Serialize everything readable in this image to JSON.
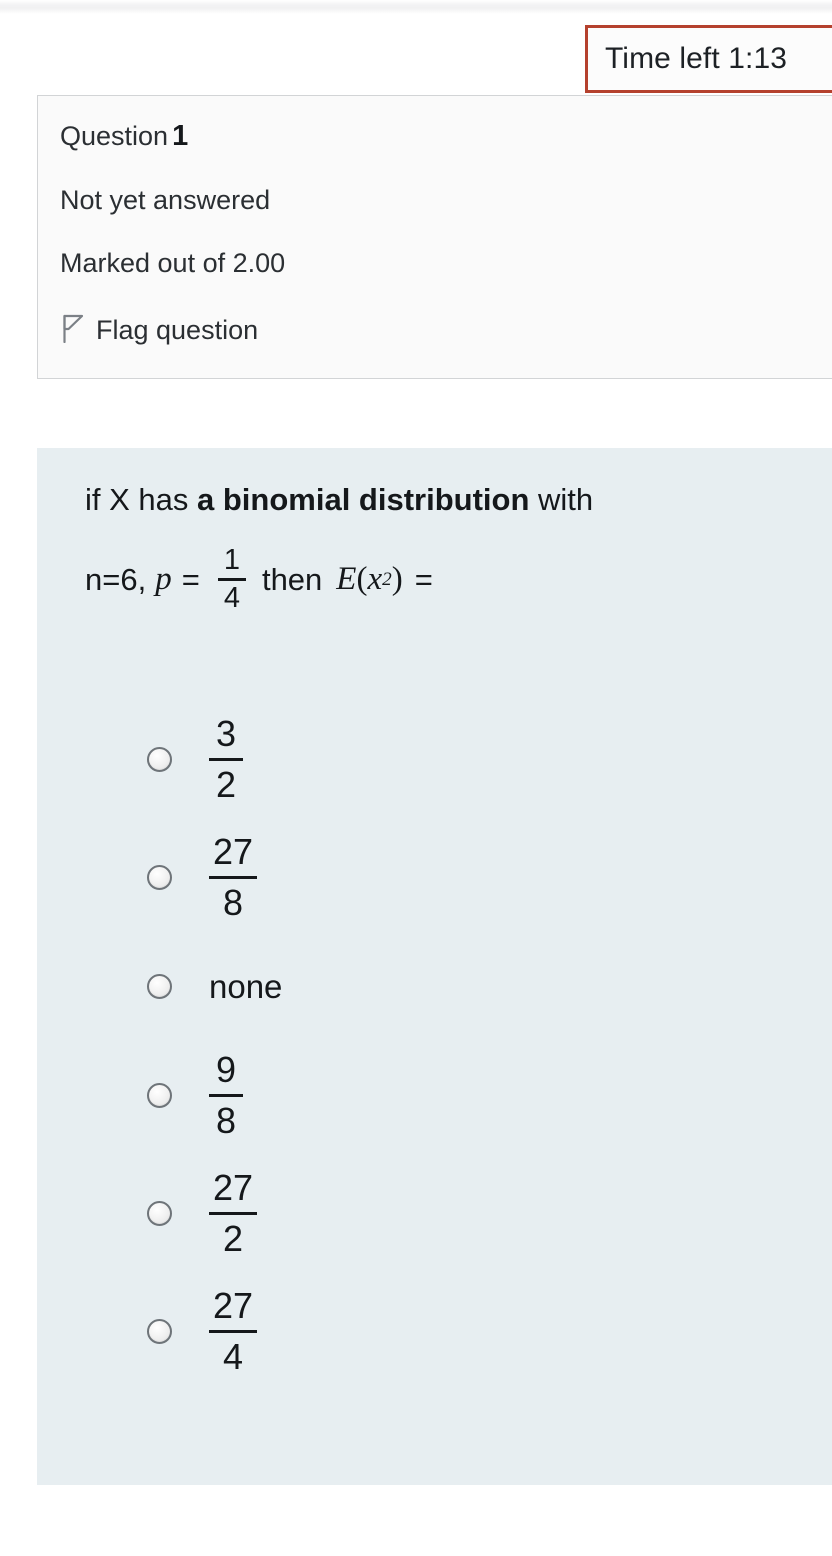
{
  "timer": {
    "label": "Time left 1:13",
    "border_color": "#b5412e"
  },
  "question_info": {
    "question_label": "Question",
    "question_number": "1",
    "status": "Not yet answered",
    "marks": "Marked out of 2.00",
    "flag_label": "Flag question",
    "flag_icon": "flag-icon"
  },
  "question": {
    "line1_prefix": "if X has ",
    "line1_bold": "a binomial distribution",
    "line1_suffix": " with",
    "given_n": "n=6,",
    "var_p": "p",
    "equals": "=",
    "p_numerator": "1",
    "p_denominator": "4",
    "then_word": "then",
    "expectation_E": "E",
    "paren_open": "(",
    "var_x": "x",
    "exponent": "2",
    "paren_close": ")",
    "trailing_equals": "="
  },
  "options": [
    {
      "id": "opt-1",
      "kind": "fraction",
      "numerator": "3",
      "denominator": "2"
    },
    {
      "id": "opt-2",
      "kind": "fraction",
      "numerator": "27",
      "denominator": "8"
    },
    {
      "id": "opt-3",
      "kind": "text",
      "text": "none"
    },
    {
      "id": "opt-4",
      "kind": "fraction",
      "numerator": "9",
      "denominator": "8"
    },
    {
      "id": "opt-5",
      "kind": "fraction",
      "numerator": "27",
      "denominator": "2"
    },
    {
      "id": "opt-6",
      "kind": "fraction",
      "numerator": "27",
      "denominator": "4"
    }
  ],
  "colors": {
    "panel_background": "#e7eef1",
    "info_background": "#fafafa",
    "timer_border": "#b5412e",
    "text": "#15181b"
  }
}
